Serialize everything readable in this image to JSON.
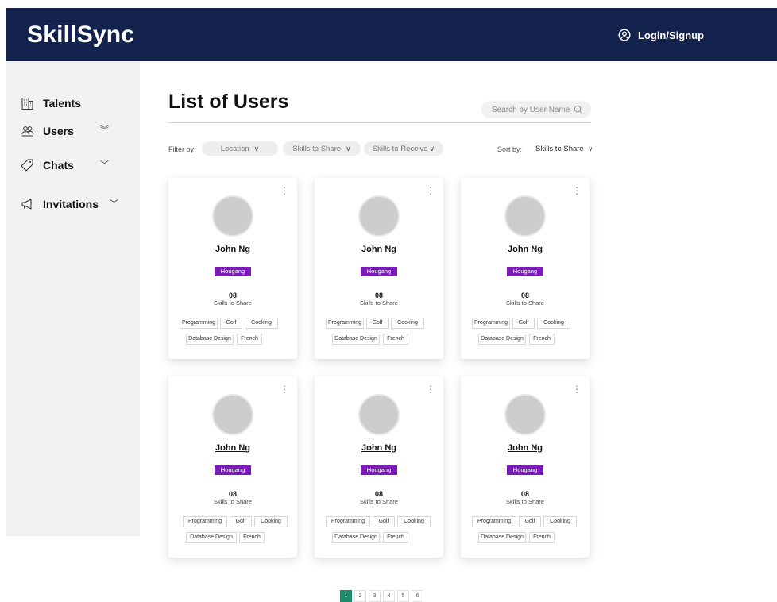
{
  "header": {
    "logo": "SkillSync",
    "login_label": "Login/Signup"
  },
  "sidebar": {
    "items": [
      {
        "label": "Talents"
      },
      {
        "label": "Users"
      },
      {
        "label": "Chats"
      },
      {
        "label": "Invitations"
      }
    ]
  },
  "main": {
    "title": "List of Users",
    "search_placeholder": "Search by User Name",
    "filter_label": "Filter by:",
    "filters": [
      "Location",
      "Skills to Share",
      "Skills to Receive"
    ],
    "sort_label": "Sort by:",
    "sort_value": "Skills to Share"
  },
  "cards": [
    {
      "name": "John Ng",
      "location": "Hougang",
      "count": "08",
      "count_label": "Skills to Share",
      "tags": [
        "Programming",
        "Golf",
        "Cooking",
        "Database Design",
        "French"
      ]
    },
    {
      "name": "John Ng",
      "location": "Hougang",
      "count": "08",
      "count_label": "Skills to Share",
      "tags": [
        "Programming",
        "Golf",
        "Cooking",
        "Database Design",
        "French"
      ]
    },
    {
      "name": "John Ng",
      "location": "Hougang",
      "count": "08",
      "count_label": "Skills to Share",
      "tags": [
        "Programming",
        "Golf",
        "Cooking",
        "Database Design",
        "French"
      ]
    },
    {
      "name": "John Ng",
      "location": "Hougang",
      "count": "08",
      "count_label": "Skills to Share",
      "tags": [
        "Programming",
        "Golf",
        "Cooking",
        "Database Design",
        "French"
      ]
    },
    {
      "name": "John Ng",
      "location": "Hougang",
      "count": "08",
      "count_label": "Skills to Share",
      "tags": [
        "Programming",
        "Golf",
        "Cooking",
        "Database Design",
        "French"
      ]
    },
    {
      "name": "John Ng",
      "location": "Hougang",
      "count": "08",
      "count_label": "Skills to Share",
      "tags": [
        "Programming",
        "Golf",
        "Cooking",
        "Database Design",
        "French"
      ]
    }
  ],
  "pagination": {
    "pages": [
      "1",
      "2",
      "3",
      "4",
      "5",
      "6"
    ],
    "current": "1"
  },
  "colors": {
    "header_bg": "#14224e",
    "location_badge": "#7a1bb7",
    "page_active": "#1f8a6a"
  },
  "icons": [
    "user-circle-icon",
    "building-icon",
    "users-icon",
    "tag-icon",
    "megaphone-icon",
    "search-icon",
    "chevron-down-icon",
    "more-vertical-icon"
  ]
}
